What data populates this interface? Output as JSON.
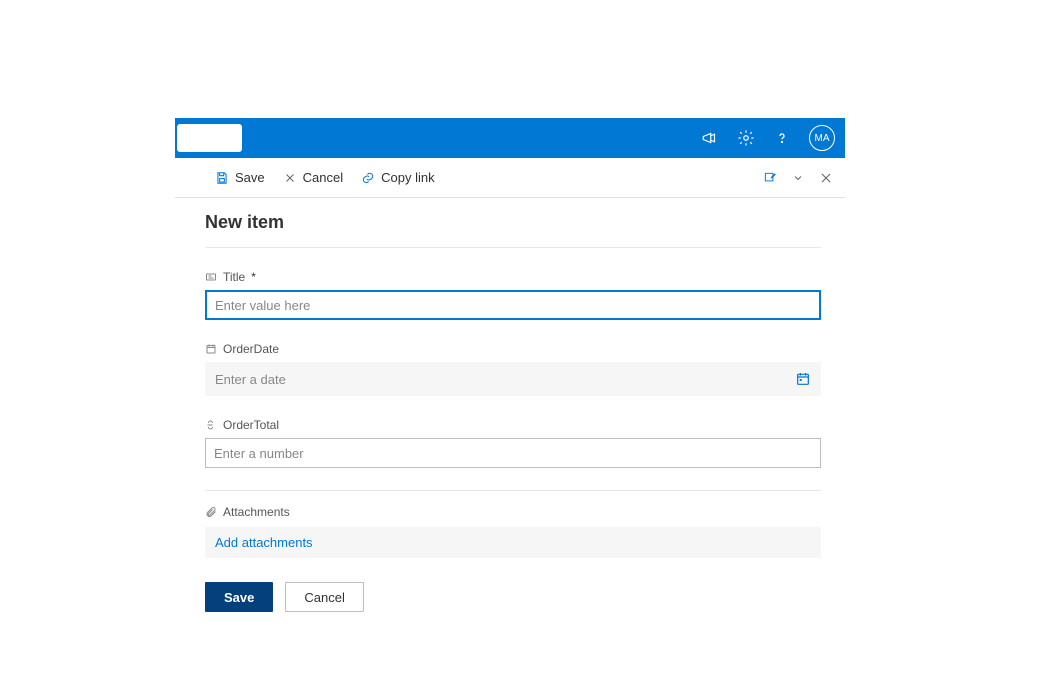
{
  "suite": {
    "avatar_initials": "MA"
  },
  "commands": {
    "save": "Save",
    "cancel": "Cancel",
    "copy_link": "Copy link"
  },
  "panel": {
    "title": "New item"
  },
  "fields": {
    "title": {
      "label": "Title",
      "required_mark": "*",
      "placeholder": "Enter value here",
      "value": ""
    },
    "order_date": {
      "label": "OrderDate",
      "placeholder": "Enter a date",
      "value": ""
    },
    "order_total": {
      "label": "OrderTotal",
      "placeholder": "Enter a number",
      "value": ""
    },
    "attachments": {
      "label": "Attachments",
      "add_link": "Add attachments"
    }
  },
  "footer": {
    "save": "Save",
    "cancel": "Cancel"
  }
}
